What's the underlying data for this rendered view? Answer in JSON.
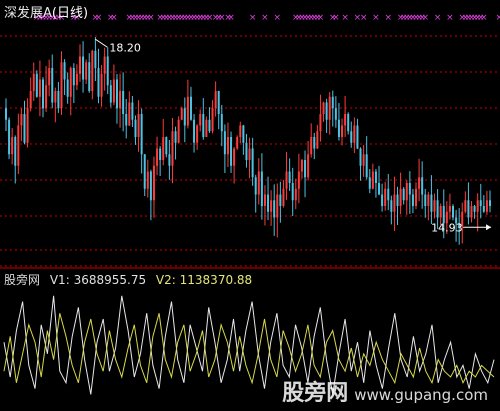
{
  "title": {
    "name": "深发展A",
    "period": "(日线)"
  },
  "indicator": {
    "name": "股旁网",
    "v1_label": "V1:",
    "v1_value": "3688955.75",
    "v2_label": "V2:",
    "v2_value": "1138370.88"
  },
  "watermark": {
    "text": "股旁网",
    "site": "www.gupang.com"
  },
  "colors": {
    "up": "#ff3c3c",
    "down": "#4cc4e4",
    "gridline": "#cc0000",
    "marker": "#e040e0",
    "v1_line": "#e8e8e8",
    "v2_line": "#d8d84a",
    "background": "#000000"
  },
  "chart_data": [
    {
      "type": "candlestick",
      "ylim": [
        14.5,
        18.5
      ],
      "annotations": [
        {
          "label": "18.20",
          "index": 29,
          "value": 18.2
        },
        {
          "label": "14.93",
          "index": 158,
          "value": 14.93
        }
      ],
      "marker_indices": [
        10,
        11,
        12,
        13,
        14,
        15,
        16,
        17,
        18,
        22,
        23,
        29,
        30,
        34,
        35,
        40,
        41,
        42,
        43,
        44,
        45,
        46,
        47,
        50,
        51,
        52,
        53,
        54,
        55,
        56,
        57,
        58,
        59,
        60,
        61,
        62,
        63,
        64,
        65,
        66,
        68,
        69,
        70,
        72,
        73,
        80,
        84,
        88,
        94,
        95,
        96,
        97,
        98,
        99,
        100,
        101,
        102,
        106,
        107,
        110,
        114,
        116,
        120,
        124,
        128,
        129,
        130,
        131,
        132,
        133,
        134,
        135,
        136,
        140,
        144,
        148,
        149,
        150,
        151,
        152,
        153,
        154,
        155,
        160,
        161,
        164
      ],
      "close": [
        16.8,
        16.2,
        16.5,
        16.0,
        16.7,
        16.9,
        16.4,
        17.0,
        17.3,
        17.6,
        17.2,
        17.5,
        17.0,
        17.4,
        17.7,
        17.1,
        17.3,
        17.0,
        17.8,
        17.5,
        17.2,
        17.7,
        17.4,
        17.6,
        17.9,
        17.5,
        17.8,
        17.3,
        18.0,
        17.7,
        17.2,
        17.6,
        17.9,
        17.4,
        17.1,
        17.5,
        17.0,
        17.3,
        16.9,
        16.7,
        17.1,
        16.8,
        16.5,
        16.9,
        16.2,
        15.6,
        15.9,
        15.4,
        16.0,
        16.3,
        16.1,
        16.5,
        16.2,
        16.0,
        16.6,
        16.4,
        16.8,
        17.0,
        16.7,
        17.2,
        16.8,
        16.4,
        16.7,
        16.9,
        16.5,
        16.8,
        16.6,
        17.0,
        17.3,
        16.9,
        16.6,
        16.2,
        16.5,
        16.0,
        16.3,
        16.5,
        16.7,
        16.4,
        16.1,
        16.3,
        15.8,
        15.5,
        15.9,
        15.3,
        15.5,
        15.2,
        15.4,
        15.1,
        15.5,
        15.3,
        15.6,
        15.9,
        15.7,
        15.4,
        15.6,
        15.9,
        16.1,
        15.8,
        16.2,
        16.5,
        16.3,
        16.6,
        16.9,
        17.1,
        16.8,
        17.2,
        17.0,
        16.8,
        16.5,
        16.7,
        16.9,
        16.6,
        16.4,
        16.7,
        16.3,
        16.0,
        16.2,
        15.8,
        15.6,
        15.9,
        15.7,
        15.5,
        15.3,
        15.6,
        15.4,
        15.2,
        15.5,
        15.3,
        15.6,
        15.4,
        15.7,
        15.5,
        15.3,
        15.6,
        15.8,
        15.5,
        15.3,
        15.5,
        15.2,
        15.4,
        15.1,
        15.3,
        15.0,
        15.2,
        15.3,
        15.1,
        15.0,
        14.95,
        15.2,
        15.4,
        15.1,
        15.3,
        15.2,
        15.4,
        15.3,
        15.2,
        15.4,
        15.3
      ]
    },
    {
      "type": "line",
      "series": [
        {
          "name": "V1",
          "values": [
            0.55,
            0.25,
            0.65,
            0.9,
            0.35,
            0.15,
            0.7,
            0.45,
            0.95,
            0.3,
            0.2,
            0.6,
            0.85,
            0.4,
            0.1,
            0.55,
            0.75,
            0.3,
            0.5,
            0.95,
            0.65,
            0.25,
            0.45,
            0.8,
            0.35,
            0.15,
            0.6,
            0.9,
            0.4,
            0.2,
            0.7,
            0.5,
            0.3,
            0.85,
            0.55,
            0.2,
            0.4,
            0.75,
            0.3,
            0.65,
            0.9,
            0.45,
            0.15,
            0.55,
            0.8,
            0.35,
            0.25,
            0.7,
            0.5,
            0.2,
            0.6,
            0.85,
            0.4,
            0.1,
            0.45,
            0.75,
            0.3,
            0.55,
            0.2,
            0.65,
            0.35,
            0.15,
            0.5,
            0.8,
            0.4,
            0.25,
            0.6,
            0.3,
            0.45,
            0.7,
            0.2,
            0.4,
            0.55,
            0.25,
            0.35,
            0.15,
            0.45,
            0.3,
            0.2,
            0.4
          ]
        },
        {
          "name": "V2",
          "values": [
            0.3,
            0.6,
            0.2,
            0.45,
            0.7,
            0.55,
            0.25,
            0.65,
            0.4,
            0.8,
            0.6,
            0.35,
            0.2,
            0.55,
            0.75,
            0.45,
            0.3,
            0.65,
            0.4,
            0.25,
            0.5,
            0.7,
            0.35,
            0.2,
            0.6,
            0.8,
            0.4,
            0.25,
            0.55,
            0.7,
            0.3,
            0.45,
            0.65,
            0.25,
            0.4,
            0.7,
            0.55,
            0.3,
            0.6,
            0.35,
            0.2,
            0.45,
            0.75,
            0.4,
            0.25,
            0.65,
            0.5,
            0.3,
            0.45,
            0.7,
            0.35,
            0.25,
            0.55,
            0.65,
            0.4,
            0.3,
            0.5,
            0.25,
            0.45,
            0.35,
            0.55,
            0.4,
            0.3,
            0.2,
            0.45,
            0.35,
            0.25,
            0.5,
            0.3,
            0.2,
            0.4,
            0.3,
            0.25,
            0.35,
            0.2,
            0.3,
            0.25,
            0.35,
            0.3,
            0.25
          ]
        }
      ]
    }
  ]
}
